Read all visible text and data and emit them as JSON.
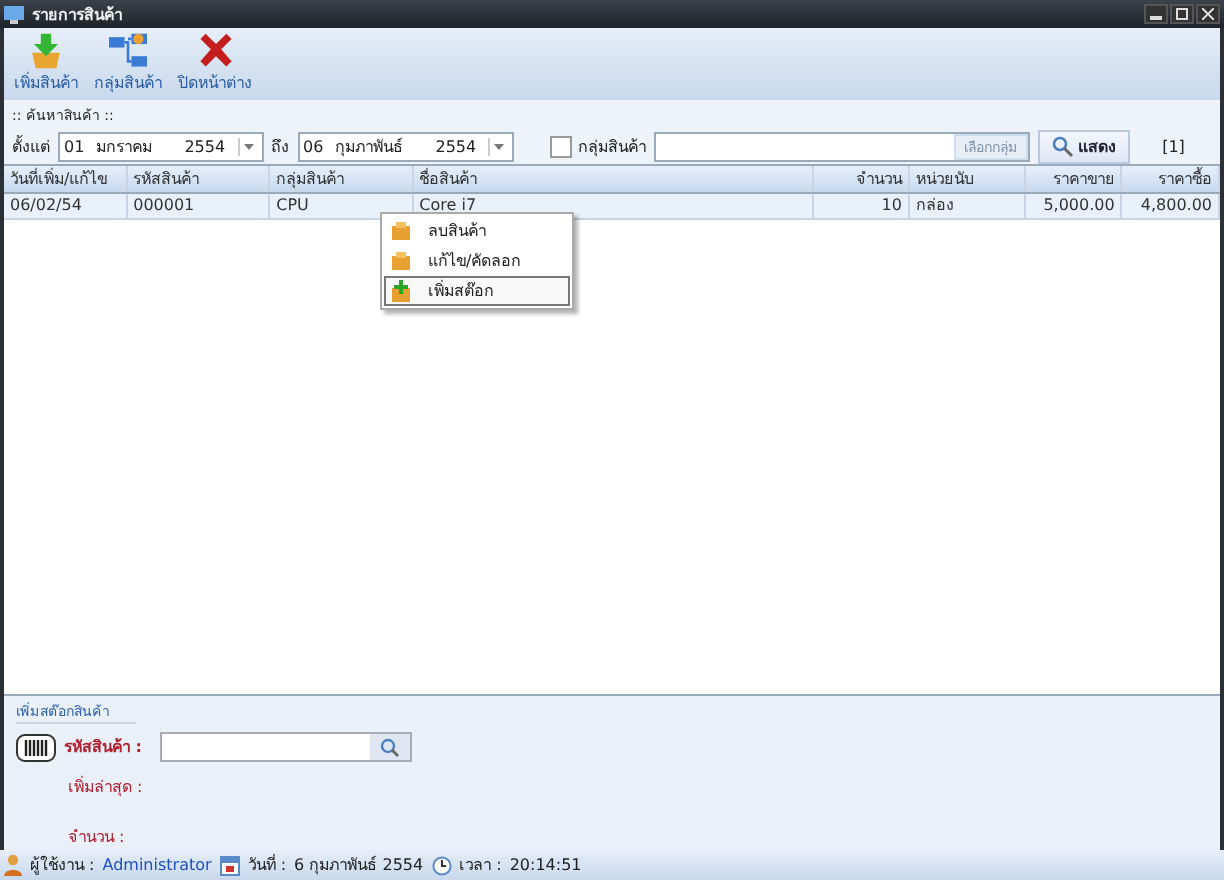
{
  "window": {
    "title": "รายการสินค้า"
  },
  "toolbar": [
    {
      "label": "เพิ่มสินค้า",
      "kind": "add"
    },
    {
      "label": "กลุ่มสินค้า",
      "kind": "group"
    },
    {
      "label": "ปิดหน้าต่าง",
      "kind": "close"
    }
  ],
  "search": {
    "title": ":: ค้นหาสินค้า ::",
    "from_label": "ตั้งแต่",
    "from": {
      "day": "01",
      "month": "มกราคม",
      "year": "2554"
    },
    "to_label": "ถึง",
    "to": {
      "day": "06",
      "month": "กุมภาพันธ์",
      "year": "2554"
    },
    "group_filter": {
      "label": "กลุ่มสินค้า",
      "checked": false
    },
    "group_button": {
      "label": "เลือกกลุ่ม",
      "disabled": true
    },
    "show_button": "แสดง",
    "count": "[1]"
  },
  "table": {
    "columns": [
      "วันที่เพิ่ม/แก้ไข",
      "รหัสสินค้า",
      "กลุ่มสินค้า",
      "ชื่อสินค้า",
      "จำนวน",
      "หน่วยนับ",
      "ราคาขาย",
      "ราคาซื้อ"
    ],
    "rows": [
      {
        "cells": [
          "06/02/54",
          "000001",
          "CPU",
          "Core i7",
          "10",
          "กล่อง",
          "5,000.00",
          "4,800.00"
        ],
        "selected": true
      }
    ]
  },
  "context_menu": [
    {
      "label": "ลบสินค้า",
      "selected": false
    },
    {
      "label": "แก้ไข/คัดลอก",
      "selected": false
    },
    {
      "label": "เพิ่มสต๊อก",
      "selected": true
    }
  ],
  "stock_panel": {
    "title": "เพิ่มสต๊อกสินค้า",
    "code_label": "รหัสสินค้า :",
    "latest_label": "เพิ่มล่าสุด :",
    "qty_label": "จำนวน :"
  },
  "status_bar": {
    "user_label": "ผู้ใช้งาน :",
    "user": "Administrator",
    "date_label": "วันที่ :",
    "date": "6 กุมภาพันธ์ 2554",
    "time_label": "เวลา :",
    "time": "20:14:51"
  }
}
